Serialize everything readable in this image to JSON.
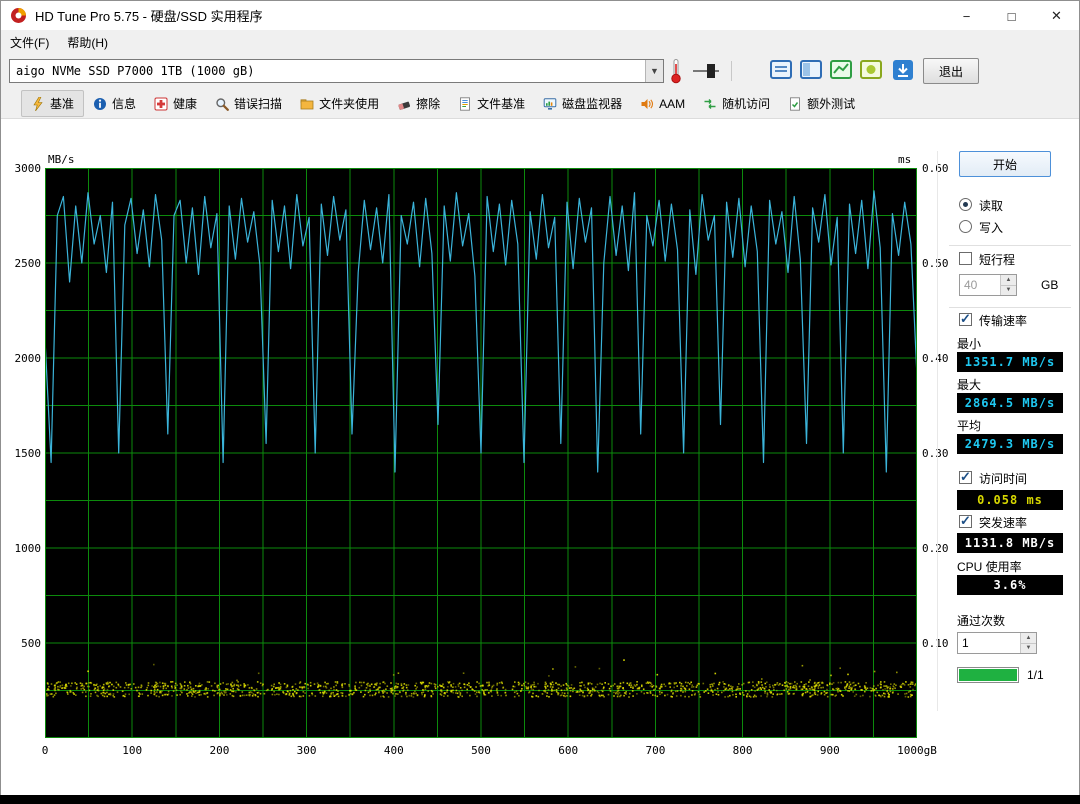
{
  "window": {
    "title": "HD Tune Pro 5.75 - 硬盘/SSD 实用程序",
    "controls": {
      "minimize": "−",
      "maximize": "□",
      "close": "✕"
    }
  },
  "menu": {
    "file": "文件(F)",
    "help": "帮助(H)"
  },
  "toolbar": {
    "drive": "aigo NVMe SSD P7000 1TB (1000 gB)",
    "exit": "退出"
  },
  "tabs": [
    {
      "label": "基准"
    },
    {
      "label": "信息"
    },
    {
      "label": "健康"
    },
    {
      "label": "错误扫描"
    },
    {
      "label": "文件夹使用"
    },
    {
      "label": "擦除"
    },
    {
      "label": "文件基准"
    },
    {
      "label": "磁盘监视器"
    },
    {
      "label": "AAM"
    },
    {
      "label": "随机访问"
    },
    {
      "label": "额外测试"
    }
  ],
  "panel": {
    "start": "开始",
    "read": "读取",
    "write": "写入",
    "short_stroke": "短行程",
    "short_stroke_value": "40",
    "short_stroke_unit": "GB",
    "transfer_rate": "传输速率",
    "min_label": "最小",
    "min_value": "1351.7 MB/s",
    "max_label": "最大",
    "max_value": "2864.5 MB/s",
    "avg_label": "平均",
    "avg_value": "2479.3 MB/s",
    "access_time": "访问时间",
    "access_time_value": "0.058 ms",
    "burst_rate": "突发速率",
    "burst_rate_value": "1131.8 MB/s",
    "cpu_usage": "CPU 使用率",
    "cpu_value": "3.6%",
    "pass_count": "通过次数",
    "pass_count_value": "1",
    "progress": "1/1"
  },
  "colors": {
    "value_cyan": "#1fc9f2",
    "value_yellow": "#d8d800",
    "value_white": "#ffffff",
    "progress_green": "#1fb141"
  },
  "chart_data": {
    "type": "line",
    "x_unit": "gB",
    "x_range": [
      0,
      1000
    ],
    "x_ticks": [
      "0",
      "100",
      "200",
      "300",
      "400",
      "500",
      "600",
      "700",
      "800",
      "900",
      "1000gB"
    ],
    "y_left_unit": "MB/s",
    "y_left_range": [
      0,
      3000
    ],
    "y_left_ticks": [
      "3000",
      "2500",
      "2000",
      "1500",
      "1000",
      "500"
    ],
    "y_right_unit": "ms",
    "y_right_range": [
      0,
      0.6
    ],
    "y_right_ticks": [
      "0.60",
      "0.50",
      "0.40",
      "0.30",
      "0.20",
      "0.10"
    ],
    "grid": {
      "color": "#0c8a0c",
      "x_step_gb": 50,
      "y_step_mbs": 250
    },
    "bg": "#000000",
    "stats": {
      "min_mbs": 1351.7,
      "max_mbs": 2864.5,
      "avg_mbs": 2479.3,
      "access_ms": 0.058,
      "burst_mbs": 1131.8,
      "cpu_pct": 3.6
    },
    "series": [
      {
        "name": "transfer_rate_mbs",
        "color": "#3bb4da",
        "values": [
          2100,
          1450,
          2750,
          2850,
          2400,
          2800,
          2500,
          2870,
          2600,
          2750,
          2450,
          2820,
          1500,
          2700,
          2840,
          2550,
          2780,
          2480,
          2860,
          2620,
          1600,
          2750,
          2830,
          2500,
          2790,
          2440,
          2850,
          2580,
          2760,
          1450,
          2800,
          2520,
          2840,
          2610,
          2770,
          2490,
          1550,
          2830,
          2560,
          2800,
          2470,
          2860,
          2590,
          2740,
          1500,
          2810,
          2540,
          2850,
          2620,
          2780,
          1600,
          2450,
          2830,
          2570,
          2790,
          2500,
          2860,
          1400,
          2750,
          2600,
          2820,
          2480,
          2840,
          2550,
          1650,
          2800,
          2510,
          2870,
          2590,
          2760,
          2430,
          1500,
          2850,
          2560,
          2810,
          2490,
          2830,
          2600,
          1450,
          2770,
          2520,
          2860,
          2580,
          2740,
          1550,
          2820,
          2470,
          2840,
          2610,
          2790,
          1400,
          2500,
          2850,
          2540,
          2800,
          2460,
          2870,
          1600,
          2750,
          2590,
          2830,
          2510,
          2810,
          2570,
          1500,
          2780,
          2440,
          2860,
          2620,
          2750,
          1650,
          2820,
          2530,
          2840,
          2480,
          2800,
          2560,
          1450,
          2830,
          2600,
          2770,
          2450,
          2850,
          2520,
          1550,
          2790,
          2610,
          2860,
          2490,
          2740,
          1500,
          2810,
          2550,
          2830,
          2470,
          2880,
          2580,
          1400,
          2760,
          2540,
          2820,
          2600,
          1900
        ]
      },
      {
        "name": "access_time_ms",
        "color": "#d8d800",
        "band_center_ms": 0.052,
        "band_halfwidth_ms": 0.008
      }
    ]
  }
}
